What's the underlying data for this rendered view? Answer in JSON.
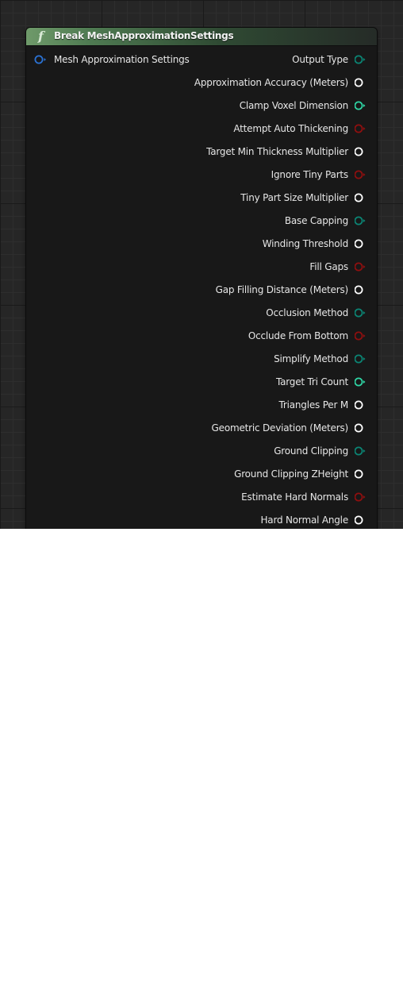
{
  "node": {
    "icon": "function-icon",
    "title": "Break MeshApproximationSettings",
    "input": {
      "label": "Mesh Approximation Settings",
      "color": "#2b73d6"
    },
    "outputs": [
      {
        "label": "Output Type",
        "type": "byte",
        "color": "#0b8574",
        "arrow": true
      },
      {
        "label": "Approximation Accuracy (Meters)",
        "type": "float",
        "color": "#ffffff",
        "arrow": false
      },
      {
        "label": "Clamp Voxel Dimension",
        "type": "int",
        "color": "#2fd6a5",
        "arrow": true
      },
      {
        "label": "Attempt Auto Thickening",
        "type": "bool",
        "color": "#8f0f0f",
        "arrow": true
      },
      {
        "label": "Target Min Thickness Multiplier",
        "type": "float",
        "color": "#ffffff",
        "arrow": false
      },
      {
        "label": "Ignore Tiny Parts",
        "type": "bool",
        "color": "#8f0f0f",
        "arrow": true
      },
      {
        "label": "Tiny Part Size Multiplier",
        "type": "float",
        "color": "#ffffff",
        "arrow": false
      },
      {
        "label": "Base Capping",
        "type": "byte",
        "color": "#0b8574",
        "arrow": true
      },
      {
        "label": "Winding Threshold",
        "type": "float",
        "color": "#ffffff",
        "arrow": false
      },
      {
        "label": "Fill Gaps",
        "type": "bool",
        "color": "#8f0f0f",
        "arrow": true
      },
      {
        "label": "Gap Filling Distance (Meters)",
        "type": "float",
        "color": "#ffffff",
        "arrow": false
      },
      {
        "label": "Occlusion Method",
        "type": "byte",
        "color": "#0b8574",
        "arrow": true
      },
      {
        "label": "Occlude From Bottom",
        "type": "bool",
        "color": "#8f0f0f",
        "arrow": true
      },
      {
        "label": "Simplify Method",
        "type": "byte",
        "color": "#0b8574",
        "arrow": true
      },
      {
        "label": "Target Tri Count",
        "type": "int",
        "color": "#2fd6a5",
        "arrow": true
      },
      {
        "label": "Triangles Per M",
        "type": "float",
        "color": "#ffffff",
        "arrow": false
      },
      {
        "label": "Geometric Deviation (Meters)",
        "type": "float",
        "color": "#ffffff",
        "arrow": false
      },
      {
        "label": "Ground Clipping",
        "type": "byte",
        "color": "#0b8574",
        "arrow": true
      },
      {
        "label": "Ground Clipping ZHeight",
        "type": "float",
        "color": "#ffffff",
        "arrow": false
      },
      {
        "label": "Estimate Hard Normals",
        "type": "bool",
        "color": "#8f0f0f",
        "arrow": true
      },
      {
        "label": "Hard Normal Angle",
        "type": "float",
        "color": "#ffffff",
        "arrow": false
      }
    ]
  }
}
